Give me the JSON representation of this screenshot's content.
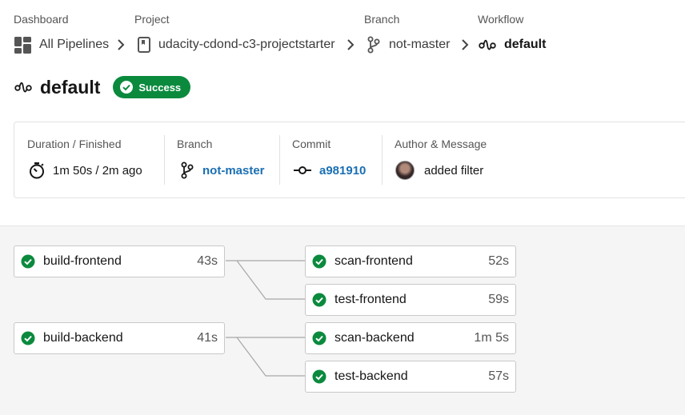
{
  "breadcrumb": {
    "labels": [
      "Dashboard",
      "Project",
      "Branch",
      "Workflow"
    ],
    "dashboard": "All Pipelines",
    "project": "udacity-cdond-c3-projectstarter",
    "branch": "not-master",
    "workflow": "default"
  },
  "header": {
    "title": "default",
    "status": "Success",
    "status_color": "#0b8a3e"
  },
  "info": {
    "duration_label": "Duration / Finished",
    "duration_value": "1m 50s / 2m ago",
    "branch_label": "Branch",
    "branch_value": "not-master",
    "commit_label": "Commit",
    "commit_value": "a981910",
    "author_label": "Author & Message",
    "author_message": "added filter"
  },
  "jobs": {
    "build_frontend": {
      "name": "build-frontend",
      "duration": "43s"
    },
    "build_backend": {
      "name": "build-backend",
      "duration": "41s"
    },
    "scan_frontend": {
      "name": "scan-frontend",
      "duration": "52s"
    },
    "test_frontend": {
      "name": "test-frontend",
      "duration": "59s"
    },
    "scan_backend": {
      "name": "scan-backend",
      "duration": "1m 5s"
    },
    "test_backend": {
      "name": "test-backend",
      "duration": "57s"
    }
  },
  "icons": {
    "dashboard": "grid-icon",
    "project": "bookmark-icon",
    "branch": "git-branch-icon",
    "workflow": "workflow-icon",
    "duration": "stopwatch-icon",
    "commit": "commit-icon",
    "job_status": "check-circle-icon"
  },
  "colors": {
    "success": "#0b8a3e",
    "link": "#1a6fb3"
  }
}
